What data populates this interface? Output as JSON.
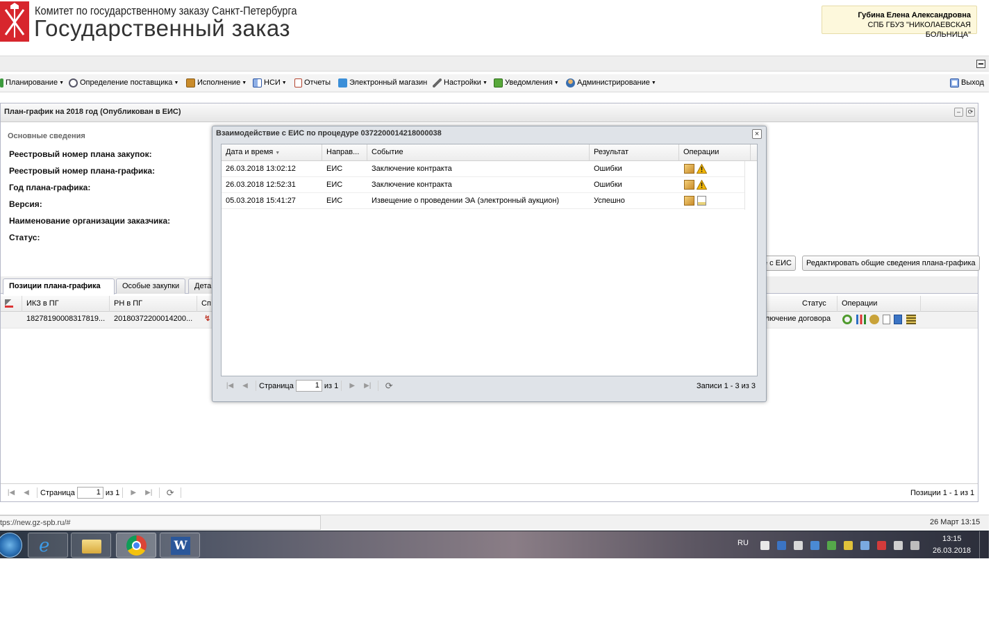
{
  "header": {
    "org": "Комитет по государственному заказу Санкт-Петербурга",
    "app_title": "Государственный заказ",
    "user_name": "Губина Елена Александровна",
    "user_org": "СПБ ГБУЗ \"НИКОЛАЕВСКАЯ БОЛЬНИЦА\""
  },
  "menu": [
    {
      "label": "Планирование",
      "icon": "grid-icon"
    },
    {
      "label": "Определение поставщика",
      "icon": "gears-icon"
    },
    {
      "label": "Исполнение",
      "icon": "briefcase-icon"
    },
    {
      "label": "НСИ",
      "icon": "book-icon"
    },
    {
      "label": "Отчеты",
      "icon": "report-icon"
    },
    {
      "label": "Электронный магазин",
      "icon": "cart-icon"
    },
    {
      "label": "Настройки",
      "icon": "wrench-icon"
    },
    {
      "label": "Уведомления",
      "icon": "notifications-icon"
    },
    {
      "label": "Администрирование",
      "icon": "user-icon"
    }
  ],
  "logout_label": "Выход",
  "panel": {
    "title": "План-график на 2018 год (Опубликован в ЕИС)",
    "section": "Основные сведения",
    "fields": [
      "Реестровый номер плана закупок:",
      "Реестровый номер плана-графика:",
      "Год плана-графика:",
      "Версия:",
      "Наименование организации заказчика:",
      "Статус:"
    ],
    "btn_eis": "е с ЕИС",
    "btn_edit": "Редактировать общие сведения плана-графика"
  },
  "tabs": [
    "Позиции плана-графика",
    "Особые закупки",
    "Дета"
  ],
  "grid": {
    "columns": [
      "ИКЗ в ПГ",
      "РН в ПГ",
      "Сп",
      "Статус",
      "Операции"
    ],
    "row": {
      "ikz": "18278190008317819...",
      "rn": "20180372200014200...",
      "status": "ключение договора"
    }
  },
  "pager_main": {
    "page_label": "Страница",
    "page_value": "1",
    "of_label": "из 1",
    "summary": "Позиции 1 - 1 из 1"
  },
  "modal": {
    "title": "Взаимодействие с ЕИС по процедуре 0372200014218000038",
    "columns": [
      "Дата и время",
      "Направ...",
      "Событие",
      "Результат",
      "Операции"
    ],
    "rows": [
      {
        "date": "26.03.2018 13:02:12",
        "dir": "ЕИС",
        "event": "Заключение контракта",
        "result": "Ошибки",
        "ops": [
          "package-icon",
          "warning-icon"
        ]
      },
      {
        "date": "26.03.2018 12:52:31",
        "dir": "ЕИС",
        "event": "Заключение контракта",
        "result": "Ошибки",
        "ops": [
          "package-icon",
          "warning-icon"
        ]
      },
      {
        "date": "05.03.2018 15:41:27",
        "dir": "ЕИС",
        "event": "Извещение о проведении ЭА (электронный аукцион)",
        "result": "Успешно",
        "ops": [
          "package-icon",
          "document-icon"
        ]
      }
    ],
    "pager": {
      "page_label": "Страница",
      "page_value": "1",
      "of_label": "из 1",
      "summary": "Записи 1 - 3 из 3"
    }
  },
  "status_bar": {
    "url": "tps://new.gz-spb.ru/#",
    "datetime": "26 Март 13:15"
  },
  "taskbar": {
    "lang": "RU",
    "time": "13:15",
    "date": "26.03.2018"
  },
  "colors": {
    "brand_red": "#d7262d",
    "warning": "#f2b705",
    "package": "#e0a63a"
  }
}
